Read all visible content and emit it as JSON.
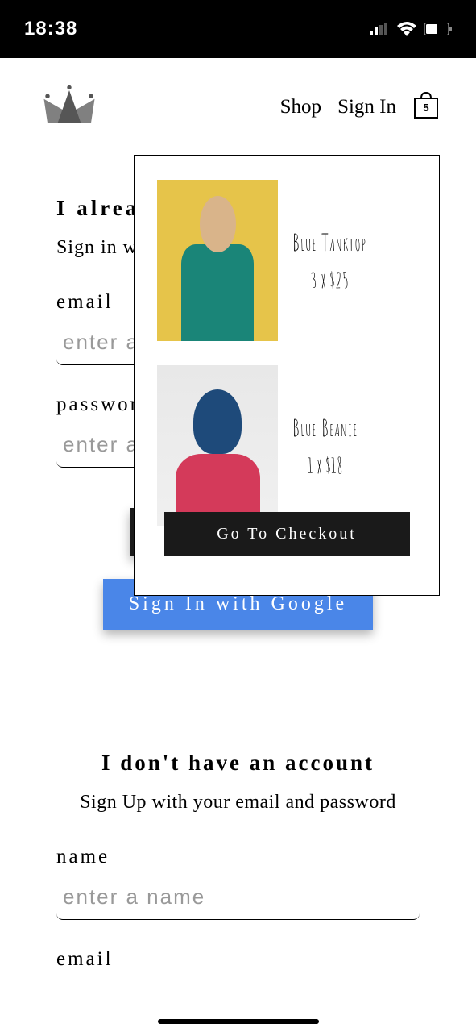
{
  "status": {
    "time": "18:38"
  },
  "nav": {
    "shop": "Shop",
    "sign_in": "Sign In",
    "cart_count": "5"
  },
  "signin": {
    "title": "I already have an account",
    "subtitle": "Sign in with your email and password",
    "email_label": "email",
    "email_placeholder": "enter an email",
    "password_label": "password",
    "password_placeholder": "enter a password",
    "google_btn": "Sign In with Google"
  },
  "signup": {
    "title": "I don't have an account",
    "subtitle": "Sign Up with your email and password",
    "name_label": "name",
    "name_placeholder": "enter a name",
    "email_label": "email"
  },
  "cart": {
    "items": [
      {
        "name": "Blue Tanktop",
        "qty": 3,
        "price": 25,
        "line": "3 x $25"
      },
      {
        "name": "Blue Beanie",
        "qty": 1,
        "price": 18,
        "line": "1 x $18"
      }
    ],
    "checkout": "Go To Checkout"
  }
}
